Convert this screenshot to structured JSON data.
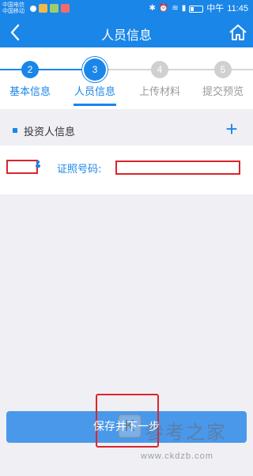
{
  "status_bar": {
    "carrier_1": "中国电信",
    "carrier_2": "中国移动",
    "network": "中午",
    "time": "11:45"
  },
  "header": {
    "title": "人员信息",
    "back_icon": "chevron-left-icon",
    "home_icon": "home-icon"
  },
  "stepper": {
    "steps": [
      {
        "number": "2",
        "label": "基本信息",
        "state": "done"
      },
      {
        "number": "3",
        "label": "人员信息",
        "state": "current"
      },
      {
        "number": "4",
        "label": "上传材料",
        "state": "todo"
      },
      {
        "number": "5",
        "label": "提交预览",
        "state": "todo"
      }
    ]
  },
  "section": {
    "title": "投资人信息",
    "add_label": "+"
  },
  "investor": {
    "id_label": "证照号码:"
  },
  "actions": {
    "save_label": "保存并下一步"
  },
  "watermark": {
    "logo": "K",
    "text": "参考之家",
    "url": "www.ckdzb.com"
  },
  "colors": {
    "primary": "#1a86e8",
    "background": "#efeff4",
    "redaction": "#d9262b"
  }
}
